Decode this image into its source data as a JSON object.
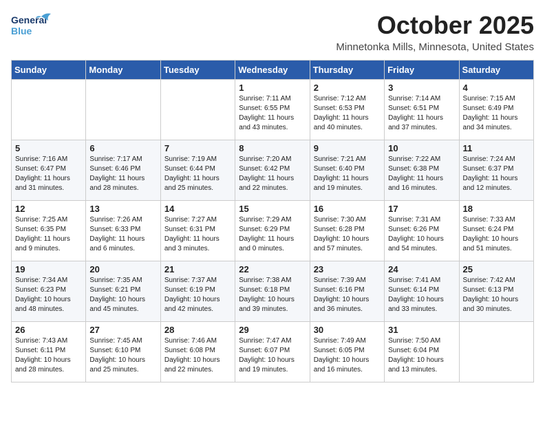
{
  "header": {
    "logo_line1": "General",
    "logo_line2": "Blue",
    "month": "October 2025",
    "location": "Minnetonka Mills, Minnesota, United States"
  },
  "weekdays": [
    "Sunday",
    "Monday",
    "Tuesday",
    "Wednesday",
    "Thursday",
    "Friday",
    "Saturday"
  ],
  "weeks": [
    [
      {
        "day": "",
        "info": ""
      },
      {
        "day": "",
        "info": ""
      },
      {
        "day": "",
        "info": ""
      },
      {
        "day": "1",
        "info": "Sunrise: 7:11 AM\nSunset: 6:55 PM\nDaylight: 11 hours\nand 43 minutes."
      },
      {
        "day": "2",
        "info": "Sunrise: 7:12 AM\nSunset: 6:53 PM\nDaylight: 11 hours\nand 40 minutes."
      },
      {
        "day": "3",
        "info": "Sunrise: 7:14 AM\nSunset: 6:51 PM\nDaylight: 11 hours\nand 37 minutes."
      },
      {
        "day": "4",
        "info": "Sunrise: 7:15 AM\nSunset: 6:49 PM\nDaylight: 11 hours\nand 34 minutes."
      }
    ],
    [
      {
        "day": "5",
        "info": "Sunrise: 7:16 AM\nSunset: 6:47 PM\nDaylight: 11 hours\nand 31 minutes."
      },
      {
        "day": "6",
        "info": "Sunrise: 7:17 AM\nSunset: 6:46 PM\nDaylight: 11 hours\nand 28 minutes."
      },
      {
        "day": "7",
        "info": "Sunrise: 7:19 AM\nSunset: 6:44 PM\nDaylight: 11 hours\nand 25 minutes."
      },
      {
        "day": "8",
        "info": "Sunrise: 7:20 AM\nSunset: 6:42 PM\nDaylight: 11 hours\nand 22 minutes."
      },
      {
        "day": "9",
        "info": "Sunrise: 7:21 AM\nSunset: 6:40 PM\nDaylight: 11 hours\nand 19 minutes."
      },
      {
        "day": "10",
        "info": "Sunrise: 7:22 AM\nSunset: 6:38 PM\nDaylight: 11 hours\nand 16 minutes."
      },
      {
        "day": "11",
        "info": "Sunrise: 7:24 AM\nSunset: 6:37 PM\nDaylight: 11 hours\nand 12 minutes."
      }
    ],
    [
      {
        "day": "12",
        "info": "Sunrise: 7:25 AM\nSunset: 6:35 PM\nDaylight: 11 hours\nand 9 minutes."
      },
      {
        "day": "13",
        "info": "Sunrise: 7:26 AM\nSunset: 6:33 PM\nDaylight: 11 hours\nand 6 minutes."
      },
      {
        "day": "14",
        "info": "Sunrise: 7:27 AM\nSunset: 6:31 PM\nDaylight: 11 hours\nand 3 minutes."
      },
      {
        "day": "15",
        "info": "Sunrise: 7:29 AM\nSunset: 6:29 PM\nDaylight: 11 hours\nand 0 minutes."
      },
      {
        "day": "16",
        "info": "Sunrise: 7:30 AM\nSunset: 6:28 PM\nDaylight: 10 hours\nand 57 minutes."
      },
      {
        "day": "17",
        "info": "Sunrise: 7:31 AM\nSunset: 6:26 PM\nDaylight: 10 hours\nand 54 minutes."
      },
      {
        "day": "18",
        "info": "Sunrise: 7:33 AM\nSunset: 6:24 PM\nDaylight: 10 hours\nand 51 minutes."
      }
    ],
    [
      {
        "day": "19",
        "info": "Sunrise: 7:34 AM\nSunset: 6:23 PM\nDaylight: 10 hours\nand 48 minutes."
      },
      {
        "day": "20",
        "info": "Sunrise: 7:35 AM\nSunset: 6:21 PM\nDaylight: 10 hours\nand 45 minutes."
      },
      {
        "day": "21",
        "info": "Sunrise: 7:37 AM\nSunset: 6:19 PM\nDaylight: 10 hours\nand 42 minutes."
      },
      {
        "day": "22",
        "info": "Sunrise: 7:38 AM\nSunset: 6:18 PM\nDaylight: 10 hours\nand 39 minutes."
      },
      {
        "day": "23",
        "info": "Sunrise: 7:39 AM\nSunset: 6:16 PM\nDaylight: 10 hours\nand 36 minutes."
      },
      {
        "day": "24",
        "info": "Sunrise: 7:41 AM\nSunset: 6:14 PM\nDaylight: 10 hours\nand 33 minutes."
      },
      {
        "day": "25",
        "info": "Sunrise: 7:42 AM\nSunset: 6:13 PM\nDaylight: 10 hours\nand 30 minutes."
      }
    ],
    [
      {
        "day": "26",
        "info": "Sunrise: 7:43 AM\nSunset: 6:11 PM\nDaylight: 10 hours\nand 28 minutes."
      },
      {
        "day": "27",
        "info": "Sunrise: 7:45 AM\nSunset: 6:10 PM\nDaylight: 10 hours\nand 25 minutes."
      },
      {
        "day": "28",
        "info": "Sunrise: 7:46 AM\nSunset: 6:08 PM\nDaylight: 10 hours\nand 22 minutes."
      },
      {
        "day": "29",
        "info": "Sunrise: 7:47 AM\nSunset: 6:07 PM\nDaylight: 10 hours\nand 19 minutes."
      },
      {
        "day": "30",
        "info": "Sunrise: 7:49 AM\nSunset: 6:05 PM\nDaylight: 10 hours\nand 16 minutes."
      },
      {
        "day": "31",
        "info": "Sunrise: 7:50 AM\nSunset: 6:04 PM\nDaylight: 10 hours\nand 13 minutes."
      },
      {
        "day": "",
        "info": ""
      }
    ]
  ]
}
